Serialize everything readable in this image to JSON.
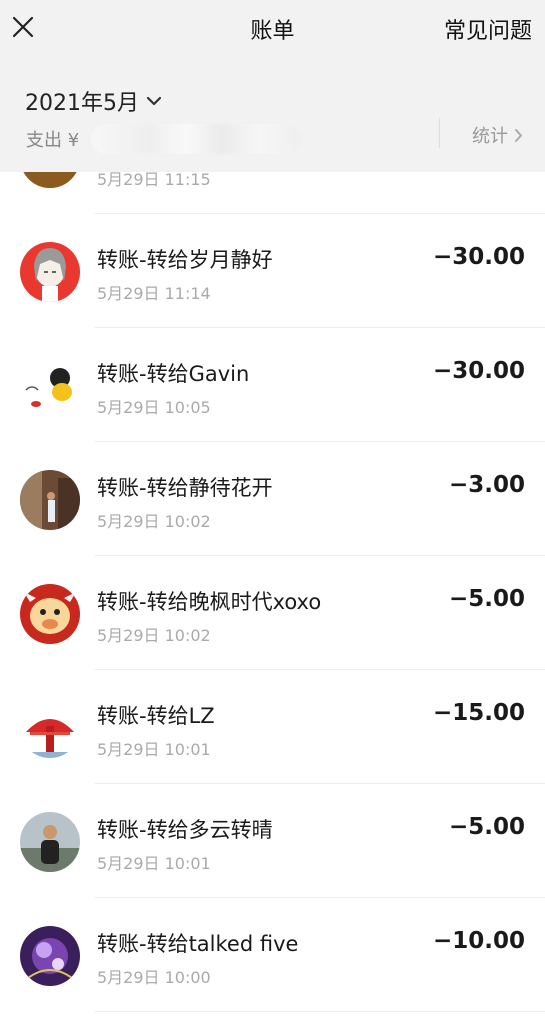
{
  "header": {
    "title": "账单",
    "faq_label": "常见问题"
  },
  "summary": {
    "month": "2021年5月",
    "expense_prefix": "支出 ¥",
    "stats_label": "统计"
  },
  "transactions": [
    {
      "title": "",
      "time": "5月29日 11:15",
      "amount": "",
      "avatar": "gold-avatar"
    },
    {
      "title": "转账-转给岁月静好",
      "time": "5月29日 11:14",
      "amount": "−30.00",
      "avatar": "anime-character-avatar"
    },
    {
      "title": "转账-转给Gavin",
      "time": "5月29日 10:05",
      "amount": "−30.00",
      "avatar": "cartoon-signature-avatar"
    },
    {
      "title": "转账-转给静待花开",
      "time": "5月29日 10:02",
      "amount": "−3.00",
      "avatar": "street-photo-avatar"
    },
    {
      "title": "转账-转给晚枫时代xoxo",
      "time": "5月29日 10:02",
      "amount": "−5.00",
      "avatar": "cartoon-cow-avatar"
    },
    {
      "title": "转账-转给LZ",
      "time": "5月29日 10:01",
      "amount": "−15.00",
      "avatar": "red-tower-avatar"
    },
    {
      "title": "转账-转给多云转晴",
      "time": "5月29日 10:01",
      "amount": "−5.00",
      "avatar": "person-photo-avatar"
    },
    {
      "title": "转账-转给talked five",
      "time": "5月29日 10:00",
      "amount": "−10.00",
      "avatar": "purple-fantasy-avatar"
    }
  ],
  "colors": {
    "header_bg": "#f2f2f2",
    "page_bg": "#ffffff",
    "text_primary": "#1a1a1a",
    "text_secondary": "#aaaaaa"
  }
}
